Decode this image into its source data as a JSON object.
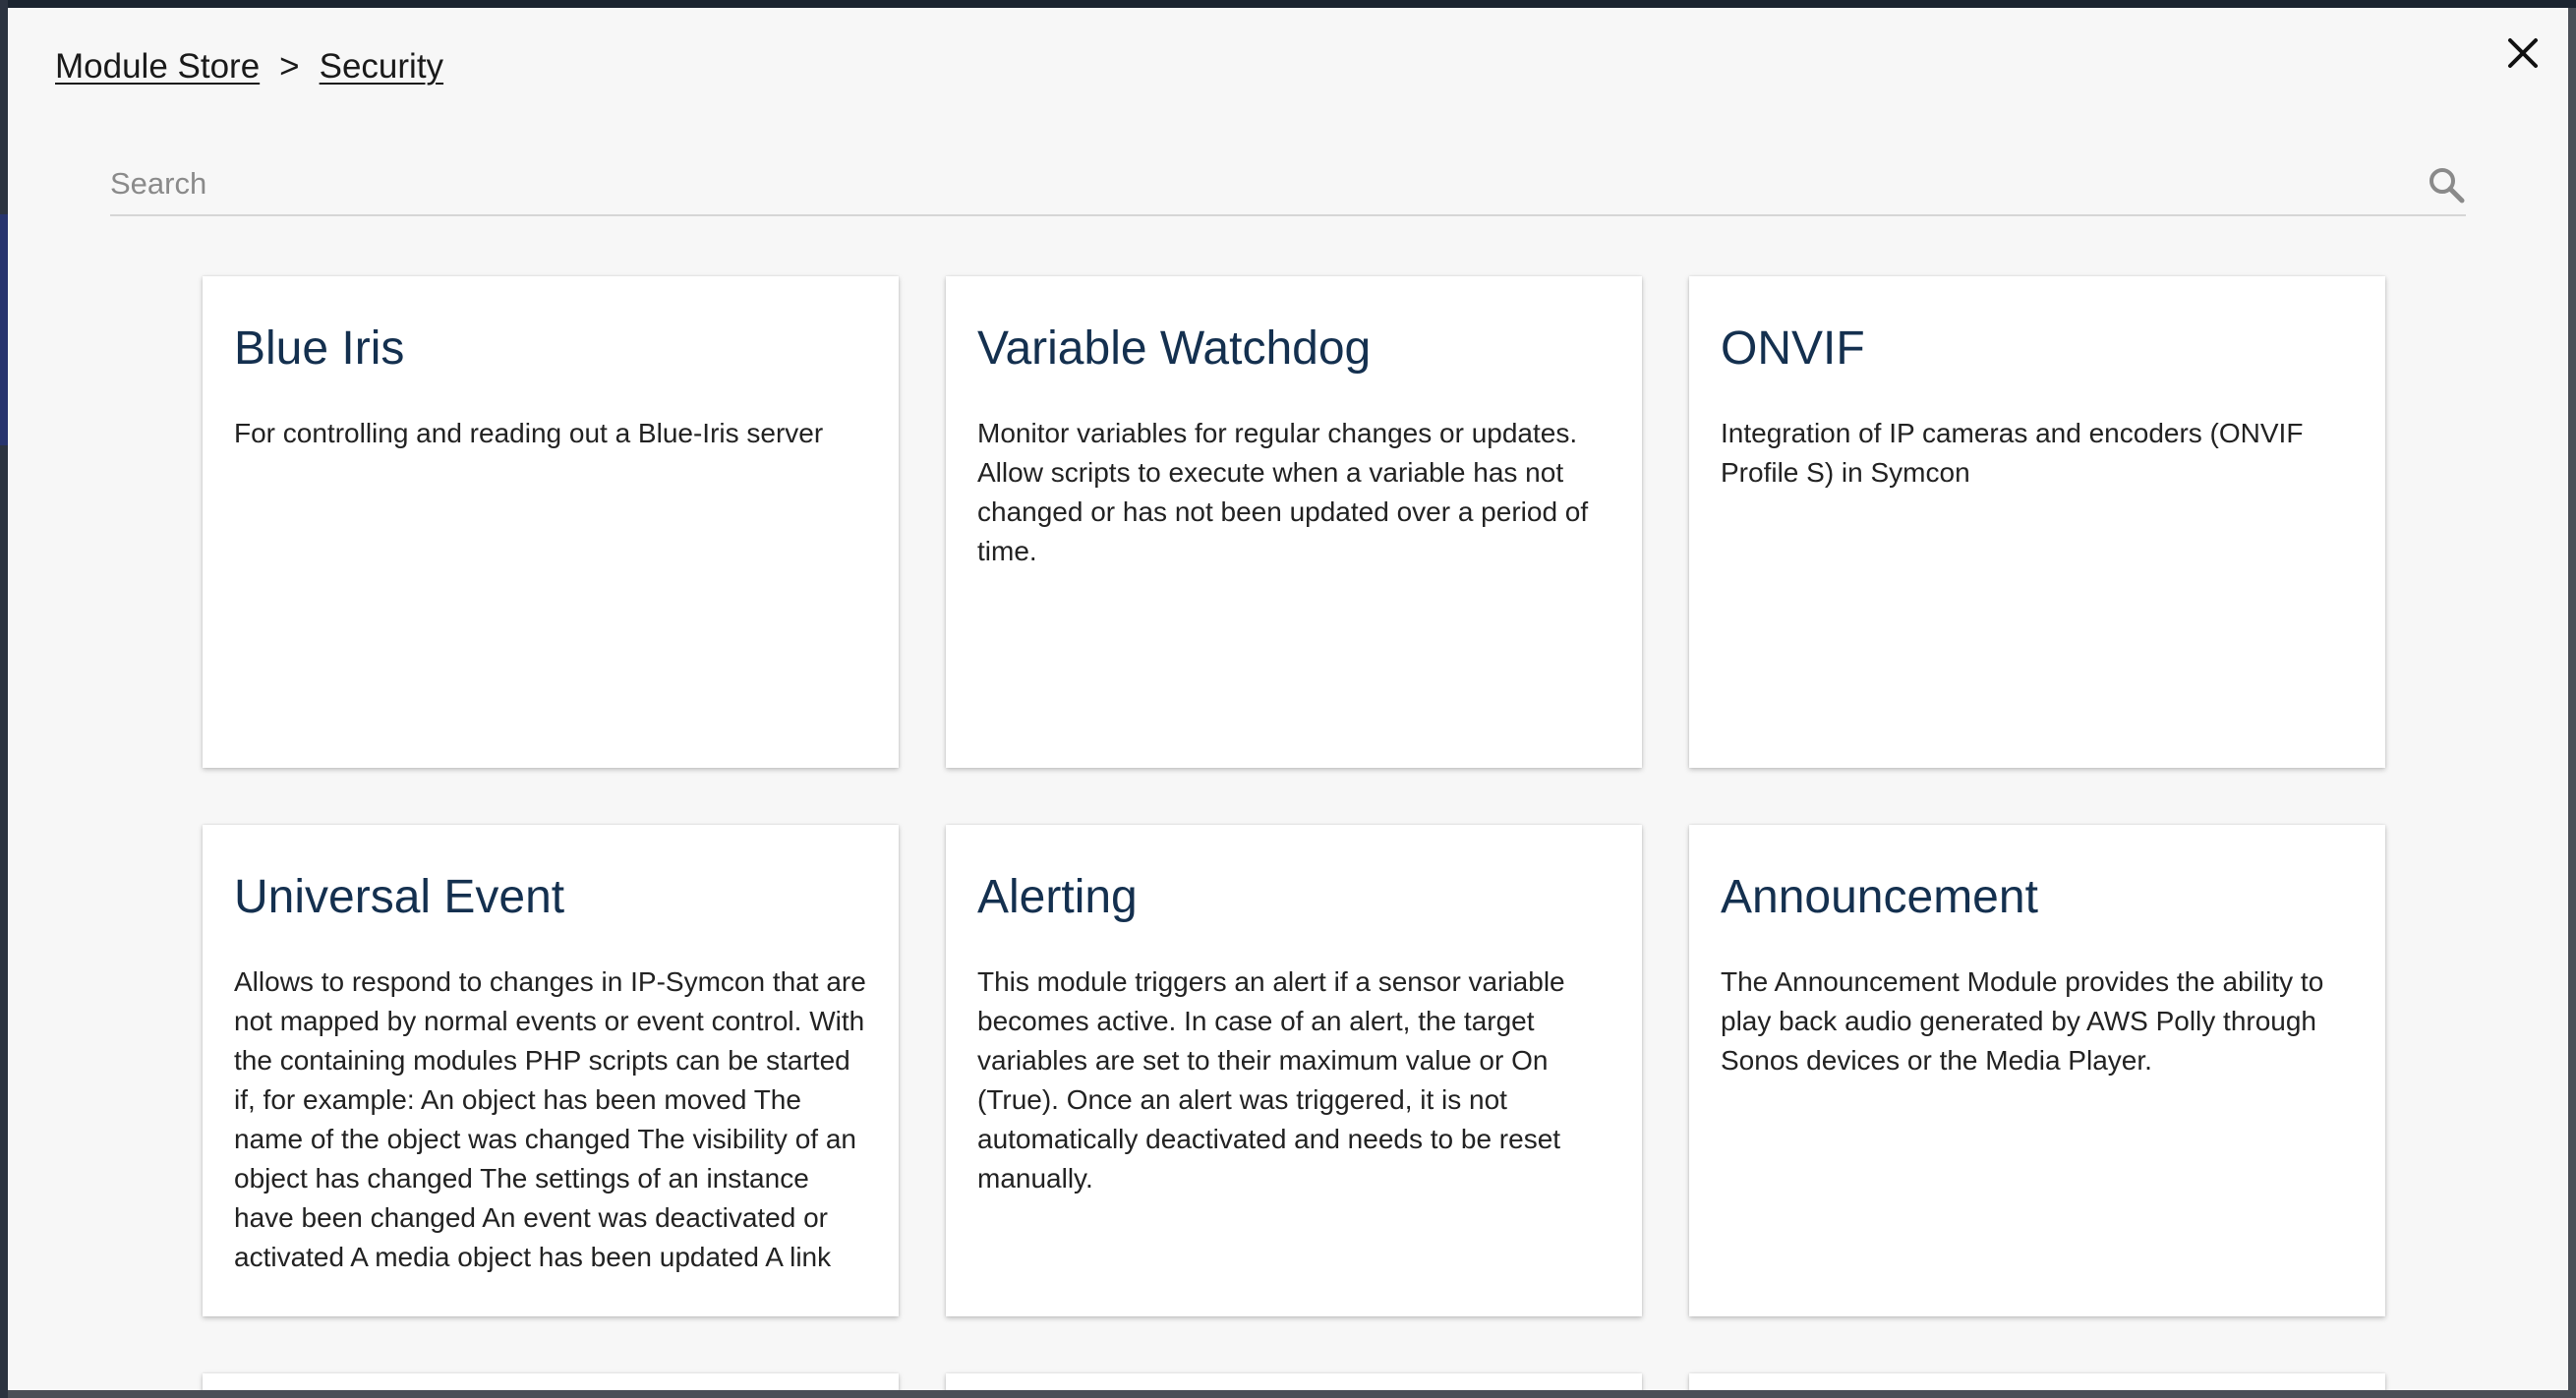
{
  "breadcrumb": {
    "root": "Module Store",
    "separator": ">",
    "current": "Security"
  },
  "close_icon": "close-icon",
  "search": {
    "placeholder": "Search",
    "value": "",
    "icon": "search-icon"
  },
  "colors": {
    "card_title": "#14304f",
    "modal_background": "#f7f7f7",
    "card_background": "#ffffff"
  },
  "modules": [
    {
      "title": "Blue Iris",
      "description": "For controlling and reading out a Blue-Iris server"
    },
    {
      "title": "Variable Watchdog",
      "description": "Monitor variables for regular changes or updates. Allow scripts to execute when a variable has not changed or has not been updated over a period of time."
    },
    {
      "title": "ONVIF",
      "description": "Integration of IP cameras and encoders (ONVIF Profile S) in Symcon"
    },
    {
      "title": "Universal Event",
      "description": "Allows to respond to changes in IP-Symcon that are not mapped by normal events or event control. With the containing modules PHP scripts can be started if, for example: An object has been moved The name of the object was changed The visibility of an object has changed The settings of an instance have been changed An event was deactivated or activated A media object has been updated A link"
    },
    {
      "title": "Alerting",
      "description": "This module triggers an alert if a sensor variable becomes active. In case of an alert, the target variables are set to their maximum value or On (True). Once an alert was triggered, it is not automatically deactivated and needs to be reset manually."
    },
    {
      "title": "Announcement",
      "description": "The Announcement Module provides the ability to play back audio generated by AWS Polly through Sonos devices or the Media Player."
    }
  ]
}
